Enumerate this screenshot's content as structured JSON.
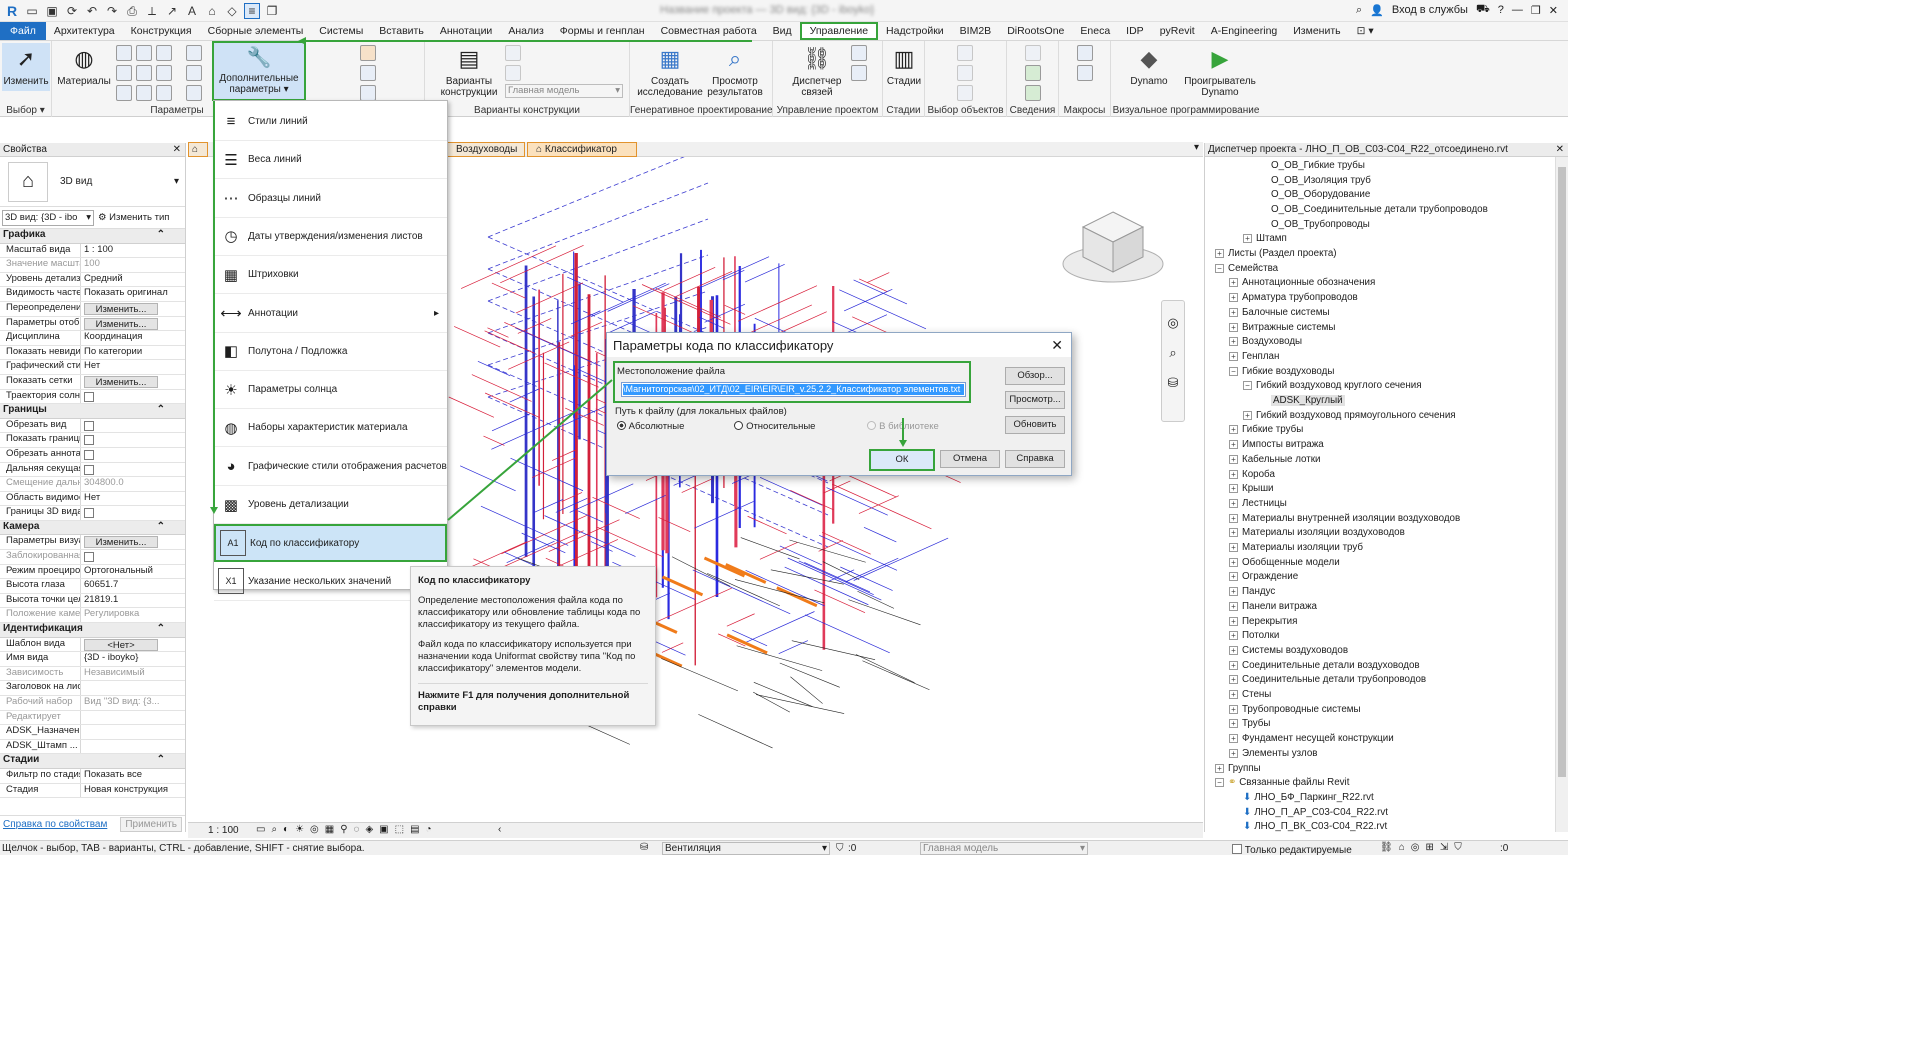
{
  "title_bar": {
    "document_title": "Название проекта — 3D вид: {3D - iboyko}",
    "signin": "Вход в службы"
  },
  "ribbon": {
    "tabs": [
      "Файл",
      "Архитектура",
      "Конструкция",
      "Сборные элементы",
      "Системы",
      "Вставить",
      "Аннотации",
      "Анализ",
      "Формы и генплан",
      "Совместная работа",
      "Вид",
      "Управление",
      "Надстройки",
      "BIM2B",
      "DiRootsOne",
      "Eneca",
      "IDP",
      "pyRevit",
      "A-Engineering",
      "Изменить"
    ],
    "active_tab": "Управление",
    "modify_label": "Изменить",
    "materials_label": "Материалы",
    "advanced_params_label": "Дополнительные параметры",
    "design_options_label": "Варианты конструкции",
    "main_model_placeholder": "Главная модель",
    "create_study_label": "Создать исследование",
    "view_results_label": "Просмотр результатов",
    "link_manager_label": "Диспетчер связей",
    "phases_label": "Стадии",
    "dynamo_label": "Dynamo",
    "dynamo_player_label": "Проигрыватель Dynamo",
    "panels": {
      "select": "Выбор",
      "params": "Параметры",
      "design_options": "Варианты конструкции",
      "generative": "Генеративное проектирование",
      "project_mgmt": "Управление проектом",
      "phases": "Стадии",
      "selection": "Выбор объектов",
      "inquiry": "Сведения",
      "macros": "Макросы",
      "visual_prog": "Визуальное программирование"
    }
  },
  "properties": {
    "title": "Свойства",
    "type_name": "3D вид",
    "view_selector": "3D вид: {3D - ibo",
    "edit_type": "Изменить тип",
    "apply": "Применить",
    "help_link": "Справка по свойствам",
    "sections": [
      {
        "name": "Графика",
        "rows": [
          {
            "k": "Масштаб вида",
            "v": "1 : 100"
          },
          {
            "k": "Значение масштаба",
            "v": "100",
            "dim": true
          },
          {
            "k": "Уровень детализации",
            "v": "Средний"
          },
          {
            "k": "Видимость частей",
            "v": "Показать оригинал"
          },
          {
            "k": "Переопределение видимости/графики",
            "btn": "Изменить..."
          },
          {
            "k": "Параметры отображения графики",
            "btn": "Изменить..."
          },
          {
            "k": "Дисциплина",
            "v": "Координация"
          },
          {
            "k": "Показать невидимые линии",
            "v": "По категории"
          },
          {
            "k": "Графический стиль по умолчанию",
            "v": "Нет"
          },
          {
            "k": "Показать сетки",
            "btn": "Изменить..."
          },
          {
            "k": "Траектория солнца",
            "cb": true
          }
        ]
      },
      {
        "name": "Границы",
        "rows": [
          {
            "k": "Обрезать вид",
            "cb": true
          },
          {
            "k": "Показать границы",
            "cb": true
          },
          {
            "k": "Обрезать аннотации",
            "cb": true
          },
          {
            "k": "Дальняя секущая плоскость",
            "cb": true
          },
          {
            "k": "Смещение дальней плоскости",
            "v": "304800.0",
            "dim": true
          },
          {
            "k": "Область видимости",
            "v": "Нет"
          },
          {
            "k": "Границы 3D вида",
            "cb": true
          }
        ]
      },
      {
        "name": "Камера",
        "rows": [
          {
            "k": "Параметры визуализации",
            "btn": "Изменить..."
          },
          {
            "k": "Заблокированная ориентация",
            "cb": true,
            "dim": true
          },
          {
            "k": "Режим проецирования",
            "v": "Ортогональный"
          },
          {
            "k": "Высота глаза",
            "v": "60651.7"
          },
          {
            "k": "Высота точки цели",
            "v": "21819.1"
          },
          {
            "k": "Положение камеры",
            "v": "Регулировка",
            "dim": true
          }
        ]
      },
      {
        "name": "Идентификация",
        "rows": [
          {
            "k": "Шаблон вида",
            "btn": "<Нет>"
          },
          {
            "k": "Имя вида",
            "v": "{3D - iboyko}"
          },
          {
            "k": "Зависимость",
            "v": "Независимый",
            "dim": true
          },
          {
            "k": "Заголовок на листе",
            "v": ""
          },
          {
            "k": "Рабочий набор",
            "v": "Вид \"3D вид: {3...",
            "dim": true
          },
          {
            "k": "Редактирует",
            "v": "",
            "dim": true
          },
          {
            "k": "ADSK_Назначение вида",
            "v": ""
          },
          {
            "k": "ADSK_Штамп ...",
            "v": ""
          }
        ]
      },
      {
        "name": "Стадии",
        "rows": [
          {
            "k": "Фильтр по стадиям",
            "v": "Показать все"
          },
          {
            "k": "Стадия",
            "v": "Новая конструкция"
          }
        ]
      }
    ]
  },
  "view_tabs": [
    "Воздуховоды",
    "Классификатор"
  ],
  "dropdown_menu": {
    "items": [
      "Стили линий",
      "Веса линий",
      "Образцы линий",
      "Даты утверждения/изменения листов",
      "Штриховки",
      "Аннотации",
      "Полутона / Подложка",
      "Параметры солнца",
      "Наборы характеристик материала",
      "Графические стили отображения расчетов",
      "Уровень детализации",
      "Код по классификатору",
      "Указание нескольких значений"
    ],
    "highlighted": "Код по классификатору"
  },
  "tooltip": {
    "title": "Код по классификатору",
    "p1": "Определение местоположения файла кода по классификатору или обновление таблицы кода по классификатору из текущего файла.",
    "p2": "Файл кода по классификатору используется при назначении кода Uniformat свойству типа \"Код по классификатору\" элементов модели.",
    "help": "Нажмите F1 для получения дополнительной справки"
  },
  "dialog": {
    "title": "Параметры кода по классификатору",
    "location_label": "Местоположение файла",
    "path_value": "\\Магнитогорская\\02_ИТД\\02_EIR\\EIR\\EIR_v.25.2.2_Классификатор элементов.txt",
    "path_type_label": "Путь к файлу (для локальных файлов)",
    "radio_absolute": "Абсолютные",
    "radio_relative": "Относительные",
    "radio_library": "В библиотеке",
    "browse": "Обзор...",
    "view": "Просмотр...",
    "reload": "Обновить",
    "ok": "ОК",
    "cancel": "Отмена",
    "help": "Справка"
  },
  "project_browser": {
    "title": "Диспетчер проекта - ЛНО_П_ОВ_С03-С04_R22_отсоединено.rvt",
    "rows": [
      {
        "t": "О_ОВ_Гибкие трубы",
        "d": 4,
        "tog": ""
      },
      {
        "t": "О_ОВ_Изоляция труб",
        "d": 4,
        "tog": ""
      },
      {
        "t": "О_ОВ_Оборудование",
        "d": 4,
        "tog": ""
      },
      {
        "t": "О_ОВ_Соединительные детали трубопроводов",
        "d": 4,
        "tog": ""
      },
      {
        "t": "О_ОВ_Трубопроводы",
        "d": 4,
        "tog": ""
      },
      {
        "t": "Штамп",
        "d": 2,
        "tog": "+"
      },
      {
        "t": "Листы (Раздел проекта)",
        "d": 0,
        "tog": "+"
      },
      {
        "t": "Семейства",
        "d": 0,
        "tog": "-"
      },
      {
        "t": "Аннотационные обозначения",
        "d": 1,
        "tog": "+"
      },
      {
        "t": "Арматура трубопроводов",
        "d": 1,
        "tog": "+"
      },
      {
        "t": "Балочные системы",
        "d": 1,
        "tog": "+"
      },
      {
        "t": "Витражные системы",
        "d": 1,
        "tog": "+"
      },
      {
        "t": "Воздуховоды",
        "d": 1,
        "tog": "+"
      },
      {
        "t": "Генплан",
        "d": 1,
        "tog": "+"
      },
      {
        "t": "Гибкие воздуховоды",
        "d": 1,
        "tog": "-"
      },
      {
        "t": "Гибкий воздуховод круглого сечения",
        "d": 2,
        "tog": "-"
      },
      {
        "t": "ADSK_Круглый",
        "d": 4,
        "tog": "",
        "sel": true
      },
      {
        "t": "Гибкий воздуховод прямоугольного сечения",
        "d": 2,
        "tog": "+"
      },
      {
        "t": "Гибкие трубы",
        "d": 1,
        "tog": "+"
      },
      {
        "t": "Импосты витража",
        "d": 1,
        "tog": "+"
      },
      {
        "t": "Кабельные лотки",
        "d": 1,
        "tog": "+"
      },
      {
        "t": "Короба",
        "d": 1,
        "tog": "+"
      },
      {
        "t": "Крыши",
        "d": 1,
        "tog": "+"
      },
      {
        "t": "Лестницы",
        "d": 1,
        "tog": "+"
      },
      {
        "t": "Материалы внутренней изоляции воздуховодов",
        "d": 1,
        "tog": "+"
      },
      {
        "t": "Материалы изоляции воздуховодов",
        "d": 1,
        "tog": "+"
      },
      {
        "t": "Материалы изоляции труб",
        "d": 1,
        "tog": "+"
      },
      {
        "t": "Обобщенные модели",
        "d": 1,
        "tog": "+"
      },
      {
        "t": "Ограждение",
        "d": 1,
        "tog": "+"
      },
      {
        "t": "Пандус",
        "d": 1,
        "tog": "+"
      },
      {
        "t": "Панели витража",
        "d": 1,
        "tog": "+"
      },
      {
        "t": "Перекрытия",
        "d": 1,
        "tog": "+"
      },
      {
        "t": "Потолки",
        "d": 1,
        "tog": "+"
      },
      {
        "t": "Системы воздуховодов",
        "d": 1,
        "tog": "+"
      },
      {
        "t": "Соединительные детали воздуховодов",
        "d": 1,
        "tog": "+"
      },
      {
        "t": "Соединительные детали трубопроводов",
        "d": 1,
        "tog": "+"
      },
      {
        "t": "Стены",
        "d": 1,
        "tog": "+"
      },
      {
        "t": "Трубопроводные системы",
        "d": 1,
        "tog": "+"
      },
      {
        "t": "Трубы",
        "d": 1,
        "tog": "+"
      },
      {
        "t": "Фундамент несущей конструкции",
        "d": 1,
        "tog": "+"
      },
      {
        "t": "Элементы узлов",
        "d": 1,
        "tog": "+"
      },
      {
        "t": "Группы",
        "d": 0,
        "tog": "+"
      },
      {
        "t": "Связанные файлы Revit",
        "d": 0,
        "tog": "-"
      },
      {
        "t": "ЛНО_БФ_Паркинг_R22.rvt",
        "d": 2,
        "tog": "",
        "link": true
      },
      {
        "t": "ЛНО_П_АР_С03-С04_R22.rvt",
        "d": 2,
        "tog": "",
        "link": true
      },
      {
        "t": "ЛНО_П_ВК_С03-С04_R22.rvt",
        "d": 2,
        "tog": "",
        "link": true
      }
    ]
  },
  "view_control": {
    "scale": "1 : 100"
  },
  "status": {
    "hint": "Щелчок - выбор, TAB - варианты, CTRL - добавление, SHIFT - снятие выбора.",
    "workset": "Вентиляция",
    "count": ":0",
    "design_option": "Главная модель",
    "editable_only": "Только редактируемые",
    "filter_count": ":0"
  },
  "colors": {
    "accent_green": "#37a43b",
    "file_tab": "#1f6fc4",
    "selection": "#3399ff"
  }
}
